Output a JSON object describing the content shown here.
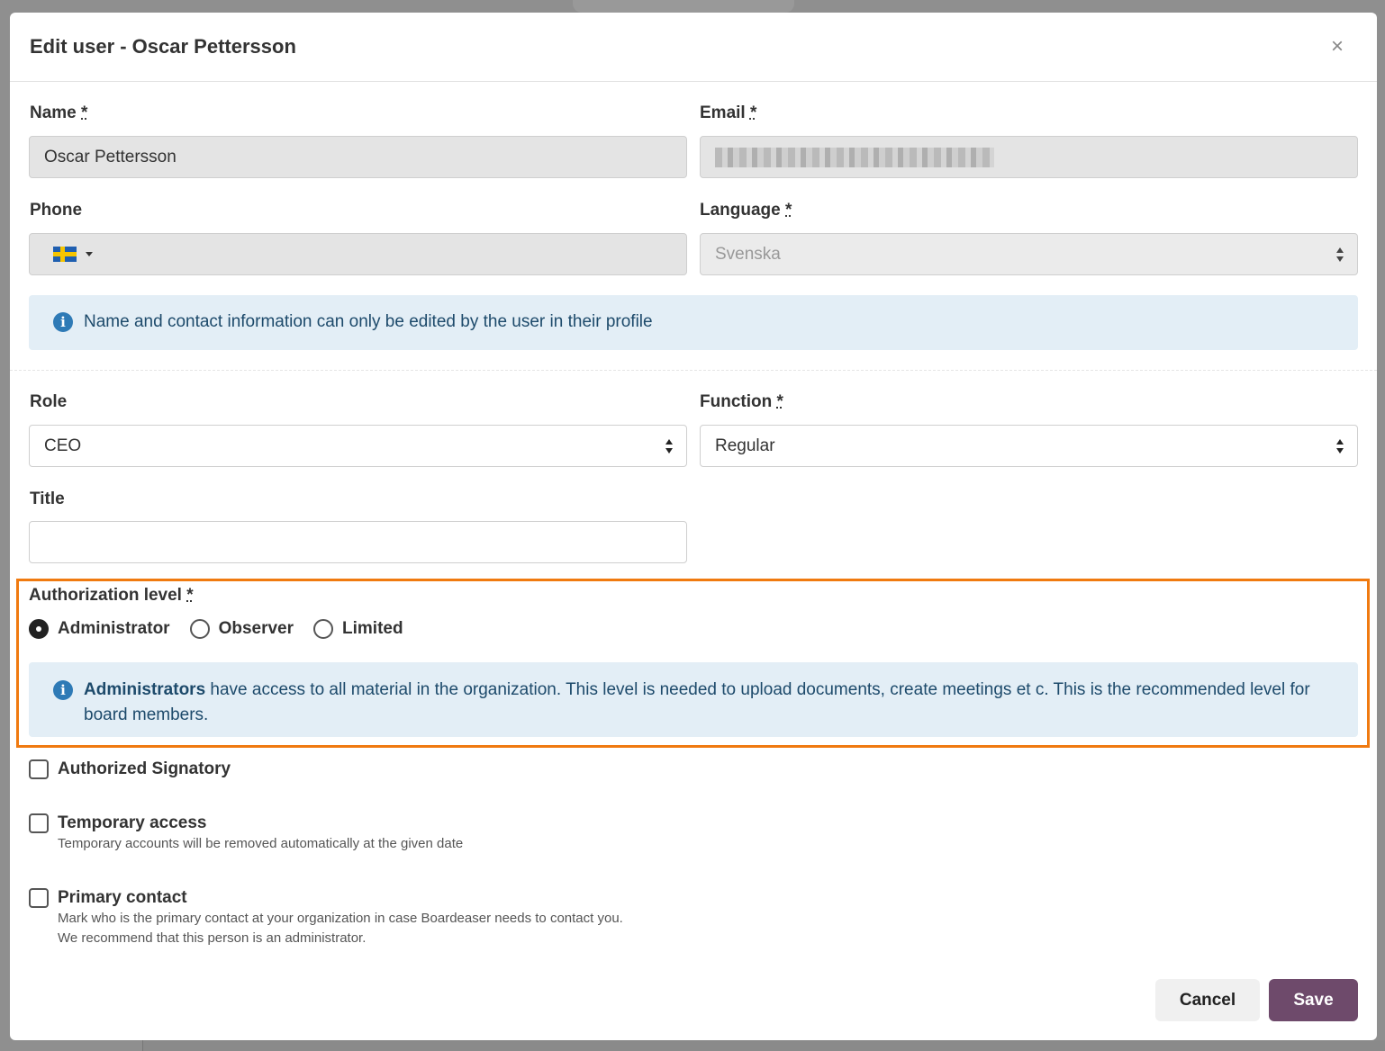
{
  "modal": {
    "title": "Edit user - Oscar Pettersson",
    "close_icon": "×"
  },
  "fields": {
    "name_label": "Name",
    "name_value": "Oscar Pettersson",
    "email_label": "Email",
    "phone_label": "Phone",
    "phone_flag_icon": "sweden-flag-icon",
    "language_label": "Language",
    "language_value": "Svenska",
    "required_mark": "*"
  },
  "contact_info_notice": "Name and contact information can only be edited by the user in their profile",
  "role": {
    "role_label": "Role",
    "role_value": "CEO",
    "function_label": "Function",
    "function_value": "Regular",
    "title_label": "Title",
    "title_value": ""
  },
  "authorization": {
    "label": "Authorization level",
    "options": [
      "Administrator",
      "Observer",
      "Limited"
    ],
    "selected": "Administrator",
    "info_bold": "Administrators",
    "info_text": " have access to all material in the organization. This level is needed to upload documents, create meetings et c. This is the recommended level for board members."
  },
  "checkboxes": {
    "authorized_signatory": "Authorized Signatory",
    "temporary_access": "Temporary access",
    "temporary_help": "Temporary accounts will be removed automatically at the given date",
    "primary_contact": "Primary contact",
    "primary_help_1": "Mark who is the primary contact at your organization in case Boardeaser needs to contact you.",
    "primary_help_2": "We recommend that this person is an administrator."
  },
  "buttons": {
    "cancel": "Cancel",
    "save": "Save"
  },
  "colors": {
    "save_button": "#6e4a6b",
    "highlight_border": "#f07a10",
    "info_background": "#e3eef6",
    "info_icon": "#2e7ab6"
  }
}
